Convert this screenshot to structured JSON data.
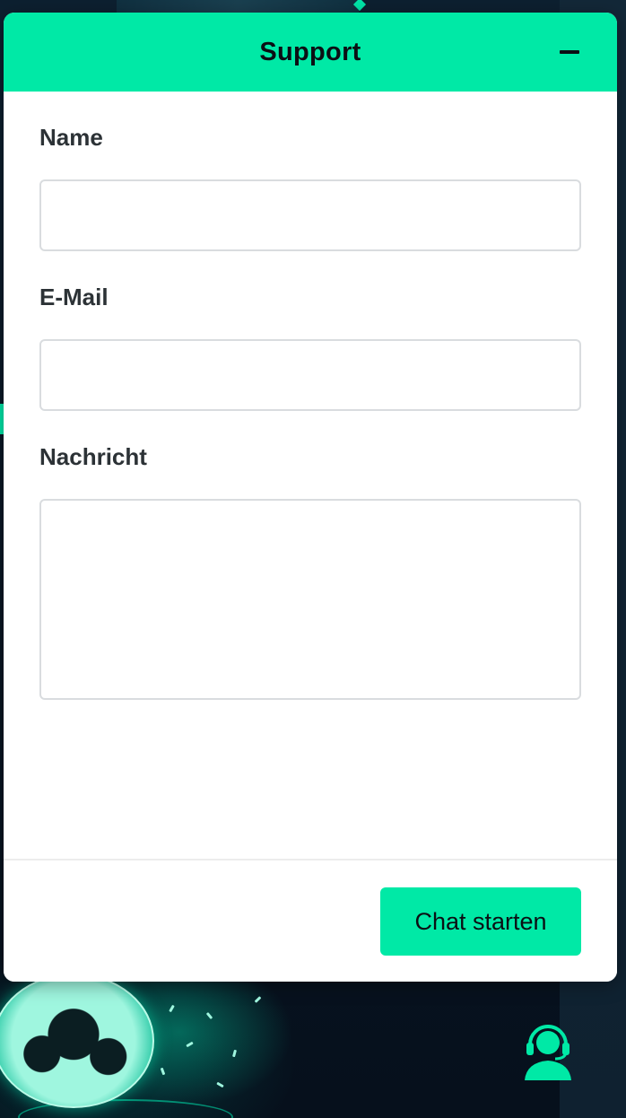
{
  "widget": {
    "title": "Support",
    "minimize_icon": "minus-icon",
    "accent_color": "#00e9a6"
  },
  "form": {
    "name": {
      "label": "Name",
      "value": "",
      "placeholder": ""
    },
    "email": {
      "label": "E-Mail",
      "value": "",
      "placeholder": ""
    },
    "message": {
      "label": "Nachricht",
      "value": "",
      "placeholder": ""
    }
  },
  "footer": {
    "start_label": "Chat starten"
  },
  "launcher": {
    "icon": "headset-agent-icon"
  }
}
